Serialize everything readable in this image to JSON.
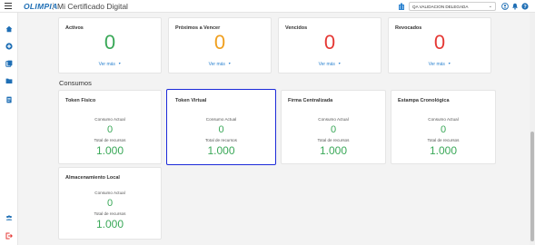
{
  "header": {
    "logo": "OLIMPIA",
    "title": "Mi Certificado Digital",
    "company": "QA VALIDACION DELEGADA"
  },
  "status_cards": [
    {
      "title": "Activos",
      "value": "0",
      "link": "Ver más",
      "color": "#3aa858"
    },
    {
      "title": "Próximos a Vencer",
      "value": "0",
      "link": "Ver más",
      "color": "#f0a020"
    },
    {
      "title": "Vencidos",
      "value": "0",
      "link": "Ver más",
      "color": "#e53935"
    },
    {
      "title": "Revocados",
      "value": "0",
      "link": "Ver más",
      "color": "#e53935"
    }
  ],
  "consumos": {
    "section_title": "Consumos",
    "cards": [
      {
        "title": "Token Físico",
        "current_label": "Consumo Actual",
        "current": "0",
        "total_label": "Total de recursos",
        "total": "1.000"
      },
      {
        "title": "Token Virtual",
        "current_label": "Consumo Actual",
        "current": "0",
        "total_label": "Total de recursos",
        "total": "1.000"
      },
      {
        "title": "Firma Centralizada",
        "current_label": "Consumo Actual",
        "current": "0",
        "total_label": "Total de recursos",
        "total": "1.000"
      },
      {
        "title": "Estampa Cronológica",
        "current_label": "Consumo Actual",
        "current": "0",
        "total_label": "Total de recursos",
        "total": "1.000"
      },
      {
        "title": "Almacenamiento Local",
        "current_label": "Consumo Actual",
        "current": "0",
        "total_label": "Total de recursos",
        "total": "1.000"
      }
    ]
  },
  "colors": {
    "brand": "#1f6fb5",
    "link": "#2f84d0",
    "selected_border": "#1c2ad9",
    "green": "#3aa858",
    "orange": "#f0a020",
    "red": "#e53935"
  }
}
